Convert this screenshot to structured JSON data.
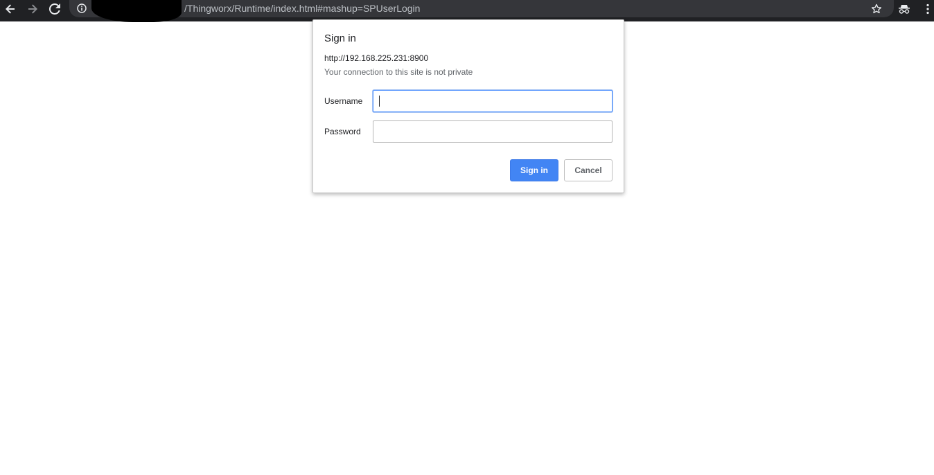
{
  "browser": {
    "url_visible_text": "/Thingworx/Runtime/index.html#mashup=SPUserLogin",
    "icons": {
      "back": "back-arrow-icon",
      "forward": "forward-arrow-icon",
      "reload": "reload-icon",
      "site_info": "info-icon",
      "bookmark": "star-icon",
      "extension": "incognito-icon",
      "menu": "kebab-menu-icon"
    }
  },
  "dialog": {
    "title": "Sign in",
    "origin": "http://192.168.225.231:8900",
    "warning": "Your connection to this site is not private",
    "username_label": "Username",
    "username_value": "",
    "password_label": "Password",
    "password_value": "",
    "signin_label": "Sign in",
    "cancel_label": "Cancel"
  },
  "colors": {
    "toolbar_bg": "#202124",
    "omnibox_bg": "#35363a",
    "primary_button": "#4285f4",
    "focus_border": "#4d90fe"
  }
}
